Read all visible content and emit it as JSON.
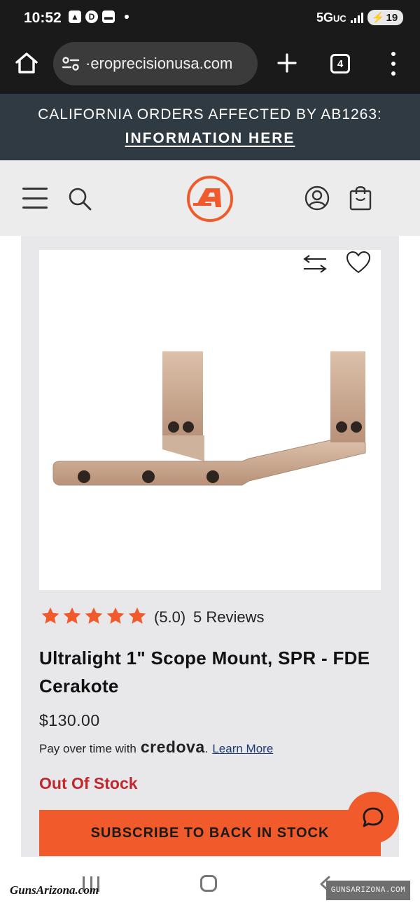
{
  "status_bar": {
    "time": "10:52",
    "network": "5G",
    "network_suffix": "UC",
    "battery": "19"
  },
  "browser": {
    "url": "·eroprecisionusa.com",
    "tab_count": "4"
  },
  "banner": {
    "line1": "CALIFORNIA ORDERS AFFECTED BY AB1263:",
    "link": "INFORMATION HERE"
  },
  "header": {
    "logo_letter": "A",
    "brand_color": "#f15a2b"
  },
  "product": {
    "rating": "(5.0)",
    "rating_value": 5,
    "reviews": "5 Reviews",
    "title": "Ultralight 1\" Scope Mount, SPR - FDE Cerakote",
    "price": "$130.00",
    "pay_prefix": "Pay over time with",
    "pay_brand": "credova",
    "pay_period": ".",
    "learn_more": "Learn More",
    "stock_status": "Out Of Stock",
    "subscribe_label": "SUBSCRIBE TO BACK IN STOCK"
  },
  "watermarks": {
    "left": "GunsArizona.com",
    "right": "GUNSARIZONA.COM"
  },
  "colors": {
    "accent": "#f15a2b",
    "banner_bg": "#2f3a42",
    "out_of_stock": "#c1272d",
    "product_fde": "#c9a58c"
  }
}
